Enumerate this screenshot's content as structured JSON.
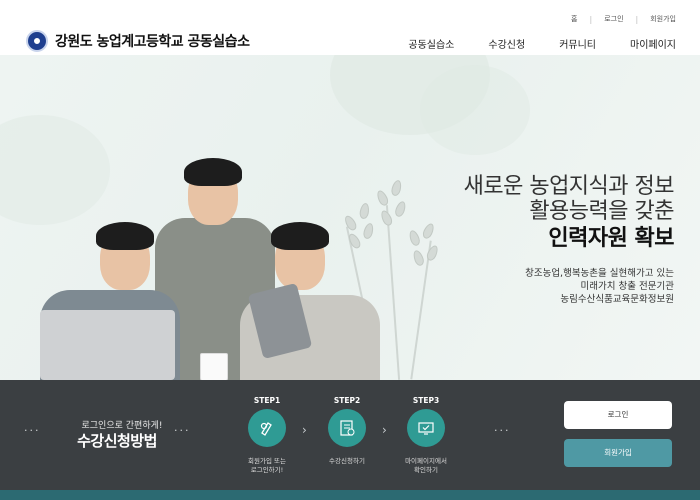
{
  "header": {
    "util_links": [
      "홈",
      "로그인",
      "회원가입"
    ],
    "logo_text": "강원도 농업계고등학교 공동실습소",
    "nav": [
      "공동실습소",
      "수강신청",
      "커뮤니티",
      "마이페이지"
    ]
  },
  "hero": {
    "title_line1": "새로운 농업지식과 정보",
    "title_line2": "활용능력을 갖춘",
    "title_line3": "인력자원 확보",
    "sub_line1": "창조농업,행복농촌을 실현해가고 있는",
    "sub_line2": "미래가치 창출 전문기관",
    "sub_line3": "농림수산식품교육문화정보원"
  },
  "guide": {
    "subtitle": "로그인으로 간편하게!",
    "title": "수강신청방법",
    "steps": [
      {
        "label": "STEP1",
        "desc_line1": "회원가입 또는",
        "desc_line2": "로그인하기!",
        "icon": "pen-hand-icon"
      },
      {
        "label": "STEP2",
        "desc_line1": "수강신청하기",
        "desc_line2": "",
        "icon": "checklist-icon"
      },
      {
        "label": "STEP3",
        "desc_line1": "마이페이지에서",
        "desc_line2": "확인하기",
        "icon": "monitor-check-icon"
      }
    ],
    "login_label": "로그인",
    "join_label": "회원가입"
  },
  "colors": {
    "teal": "#2f9b94",
    "dark_bar": "#3b3f42",
    "join_button": "#4f99a4",
    "logo_blue": "#1f3f8f"
  }
}
